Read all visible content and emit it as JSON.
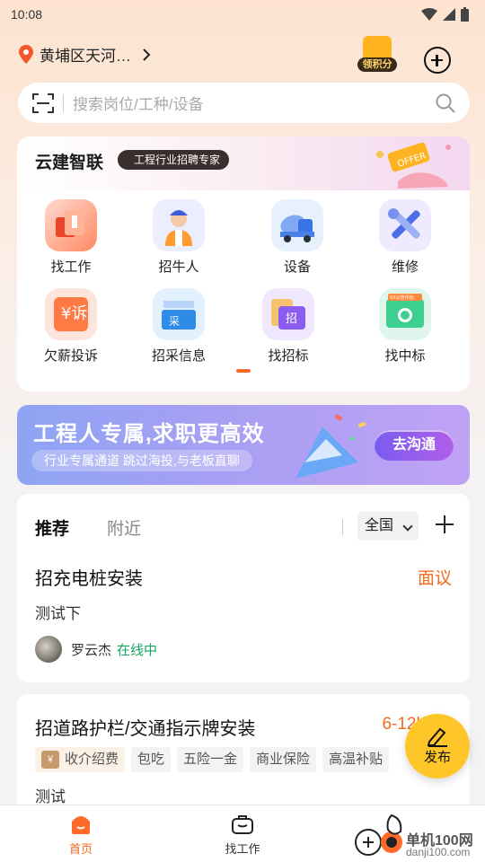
{
  "status_bar": {
    "time": "10:08"
  },
  "location": {
    "text": "黄埔区天河…"
  },
  "points_button": {
    "label": "领积分"
  },
  "search": {
    "placeholder": "搜索岗位/工种/设备"
  },
  "promo": {
    "brand": "云建智联",
    "tag": "工程行业招聘专家",
    "offer_badge": "OFFER",
    "grid": [
      {
        "label": "找工作",
        "icon": "find-job-icon"
      },
      {
        "label": "招牛人",
        "icon": "worker-icon"
      },
      {
        "label": "设备",
        "icon": "mixer-truck-icon"
      },
      {
        "label": "维修",
        "icon": "repair-tools-icon"
      },
      {
        "label": "欠薪投诉",
        "icon": "complaint-icon",
        "badge": "¥诉"
      },
      {
        "label": "招采信息",
        "icon": "procurement-icon",
        "badge": "采"
      },
      {
        "label": "找招标",
        "icon": "tender-icon",
        "badge": "招"
      },
      {
        "label": "找中标",
        "icon": "bid-win-icon",
        "badge": "XX公告中标"
      }
    ]
  },
  "banner": {
    "title": "工程人专属,求职更高效",
    "subtitle": "行业专属通道 跳过海投,与老板直聊",
    "button": "去沟通"
  },
  "feed": {
    "tabs": [
      "推荐",
      "附近"
    ],
    "region": "全国",
    "jobs": [
      {
        "title": "招充电桩安装",
        "salary": "面议",
        "desc": "测试下",
        "poster": "罗云杰",
        "status": "在线中"
      },
      {
        "title": "招道路护栏/交通指示牌安装",
        "salary": "6-12k",
        "tags": [
          "收介绍费",
          "包吃",
          "五险一金",
          "商业保险",
          "高温补贴"
        ],
        "tag_badge": "¥",
        "desc": "测试"
      }
    ]
  },
  "fab": {
    "label": "发布"
  },
  "bottom_nav": [
    {
      "label": "首页",
      "icon": "home-icon"
    },
    {
      "label": "找工作",
      "icon": "briefcase-icon"
    }
  ],
  "watermark": {
    "text": "单机100网",
    "sub": "danji100.com"
  },
  "colors": {
    "accent": "#f26b1d",
    "online": "#17a65f",
    "fab": "#ffc629"
  }
}
